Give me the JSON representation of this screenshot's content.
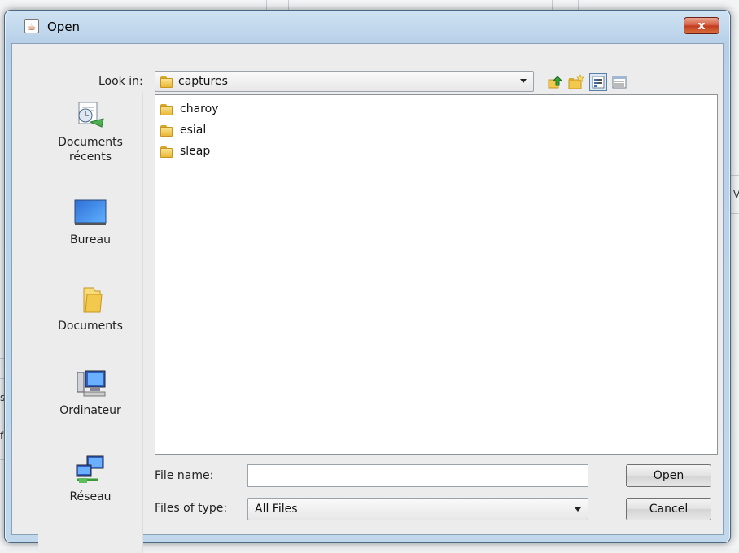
{
  "dialog": {
    "title": "Open",
    "close_label": "x"
  },
  "toolbar": {
    "lookin_label": "Look in:",
    "lookin_value": "captures",
    "buttons": [
      "up-folder-icon",
      "new-folder-icon",
      "list-view-icon",
      "details-view-icon"
    ]
  },
  "places": [
    {
      "label": "Documents récents",
      "icon": "recent-documents-icon"
    },
    {
      "label": "Bureau",
      "icon": "desktop-icon"
    },
    {
      "label": "Documents",
      "icon": "documents-folder-icon"
    },
    {
      "label": "Ordinateur",
      "icon": "computer-icon"
    },
    {
      "label": "Réseau",
      "icon": "network-icon"
    }
  ],
  "files": [
    {
      "name": "charoy",
      "icon": "folder-icon"
    },
    {
      "name": "esial",
      "icon": "folder-icon"
    },
    {
      "name": "sleap",
      "icon": "folder-icon"
    }
  ],
  "form": {
    "file_name_label": "File name:",
    "file_name_value": "",
    "file_type_label": "Files of type:",
    "file_type_value": "All Files"
  },
  "actions": {
    "open_label": "Open",
    "cancel_label": "Cancel"
  },
  "background": {
    "fragments": [
      "s",
      "fa",
      "V"
    ]
  }
}
